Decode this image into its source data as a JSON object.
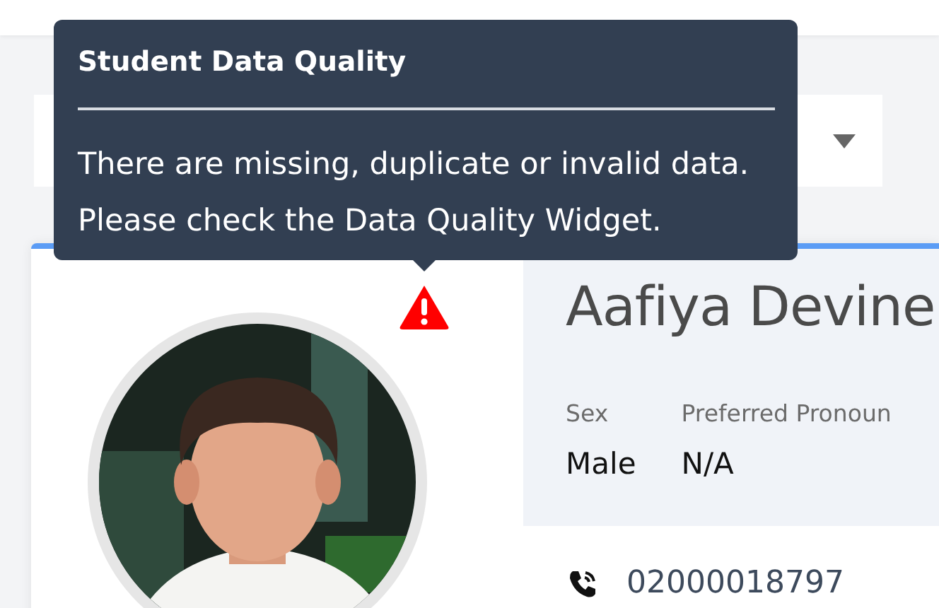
{
  "tooltip": {
    "title": "Student Data Quality",
    "lines": [
      "There are missing, duplicate or invalid data.",
      "Please check the Data Quality Widget."
    ]
  },
  "dropdown": {
    "expanded": false
  },
  "student": {
    "name": "Aafiya Devine",
    "data_quality_warning": true,
    "fields": [
      {
        "label": "Sex",
        "value": "Male"
      },
      {
        "label": "Preferred Pronoun",
        "value": "N/A"
      }
    ],
    "phone": "02000018797"
  }
}
